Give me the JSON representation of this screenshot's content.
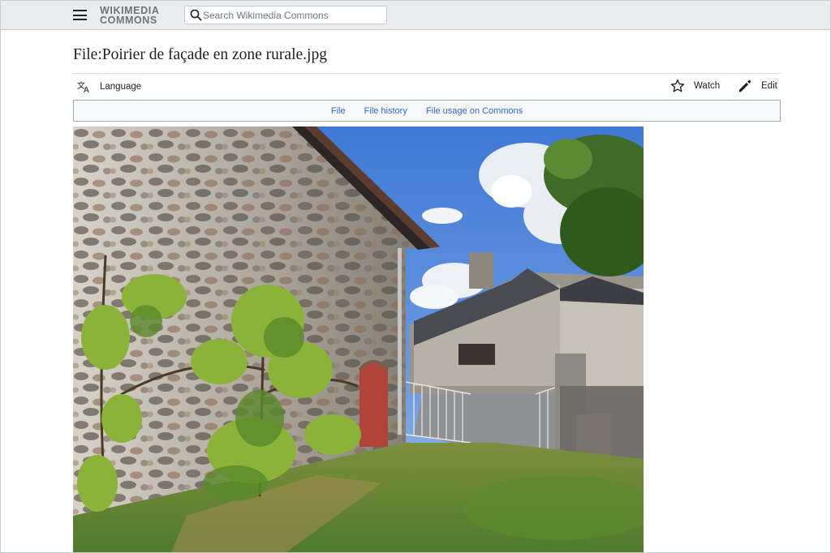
{
  "header": {
    "menu_icon": "hamburger-menu-icon",
    "logo_line1": "WIKIMEDIA",
    "logo_line2": "COMMONS",
    "search_placeholder": "Search Wikimedia Commons",
    "search_icon": "search-icon"
  },
  "page": {
    "title": "File:Poirier de façade en zone rurale.jpg"
  },
  "toolbar": {
    "language_label": "Language",
    "language_icon": "translate-icon",
    "watch_label": "Watch",
    "watch_icon": "star-icon",
    "edit_label": "Edit",
    "edit_icon": "pencil-icon"
  },
  "tabs": [
    {
      "label": "File"
    },
    {
      "label": "File history"
    },
    {
      "label": "File usage on Commons"
    }
  ],
  "colors": {
    "link": "#3366cc",
    "header_bg": "#eaecf0",
    "text": "#202122"
  }
}
